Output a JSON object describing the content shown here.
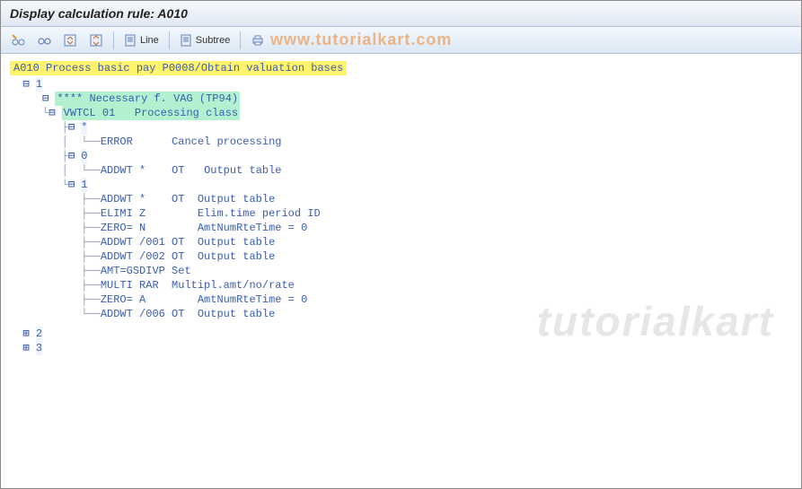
{
  "title": "Display calculation rule: A010",
  "toolbar": {
    "line_label": "Line",
    "subtree_label": "Subtree"
  },
  "watermark_top": "www.tutorialkart.com",
  "watermark_main": "tutorialkart",
  "root": {
    "code": "A010",
    "text": "Process basic pay P0008/Obtain valuation bases"
  },
  "tree": {
    "n1": "1",
    "n1_stars": {
      "code": "****",
      "text": "Necessary f. VAG (TP94)"
    },
    "n1_vwtcl": {
      "code": "VWTCL 01",
      "text": "Processing class"
    },
    "star": "*",
    "star_error": {
      "code": "ERROR",
      "text": "Cancel processing"
    },
    "zero": "0",
    "zero_addwt": {
      "code": "ADDWT *",
      "mid": "OT",
      "text": "Output table"
    },
    "one": "1",
    "one_items": [
      {
        "code": "ADDWT *   ",
        "mid": "OT  ",
        "text": "Output table"
      },
      {
        "code": "ELIMI Z   ",
        "mid": "    ",
        "text": "Elim.time period ID"
      },
      {
        "code": "ZERO= N   ",
        "mid": "    ",
        "text": "AmtNumRteTime = 0"
      },
      {
        "code": "ADDWT /001",
        "mid": " OT  ",
        "text": "Output table"
      },
      {
        "code": "ADDWT /002",
        "mid": " OT  ",
        "text": "Output table"
      },
      {
        "code": "AMT=GSDIVP",
        "mid": " ",
        "text": "Set"
      },
      {
        "code": "MULTI RAR ",
        "mid": "",
        "text": "Multipl.amt/no/rate"
      },
      {
        "code": "ZERO= A   ",
        "mid": "    ",
        "text": "AmtNumRteTime = 0"
      },
      {
        "code": "ADDWT /006",
        "mid": " OT  ",
        "text": "Output table"
      }
    ],
    "n2": "2",
    "n3": "3"
  }
}
